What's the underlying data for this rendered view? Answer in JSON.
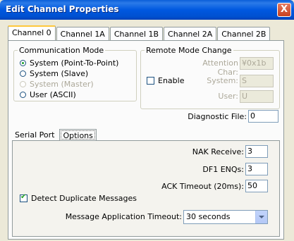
{
  "window": {
    "title": "Edit Channel Properties",
    "close_label": "X"
  },
  "tabs": [
    {
      "label": "Channel 0"
    },
    {
      "label": "Channel 1A"
    },
    {
      "label": "Channel 1B"
    },
    {
      "label": "Channel 2A"
    },
    {
      "label": "Channel 2B"
    }
  ],
  "comm_mode": {
    "legend": "Communication Mode",
    "options": [
      {
        "label": "System (Point-To-Point)"
      },
      {
        "label": "System (Slave)"
      },
      {
        "label": "System (Master)"
      },
      {
        "label": "User (ASCII)"
      }
    ]
  },
  "remote": {
    "legend": "Remote Mode Change",
    "enable_label": "Enable",
    "attention_label": "Attention Char:",
    "attention_value": "¥0x1b",
    "system_label": "System:",
    "system_value": "S",
    "user_label": "User:",
    "user_value": "U"
  },
  "diagnostic": {
    "label": "Diagnostic File:",
    "value": "0"
  },
  "subtabs": [
    {
      "label": "Serial Port"
    },
    {
      "label": "Options"
    }
  ],
  "options": {
    "nak_label": "NAK Receive:",
    "nak_value": "3",
    "df1_label": "DF1 ENQs:",
    "df1_value": "3",
    "ack_label": "ACK Timeout (20ms):",
    "ack_value": "50",
    "detect_label": "Detect Duplicate Messages",
    "msg_label": "Message Application Timeout:",
    "msg_value": "30 seconds"
  }
}
